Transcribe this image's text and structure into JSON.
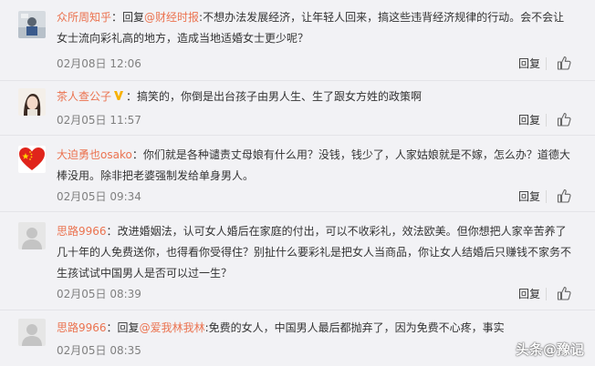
{
  "comments": [
    {
      "user": "众所周知乎",
      "pre": "：回复",
      "mention": "@财经时报",
      "body": ":不想办法发展经济，让年轻人回来，搞这些违背经济规律的行动。会不会让女士流向彩礼高的地方，造成当地适婚女士更少呢？",
      "time": "02月08日 12:06",
      "reply": "回复"
    },
    {
      "user": "茶人查公子",
      "pre": "：",
      "mention": "",
      "body": "搞笑的，你倒是出台孩子由男人生、生了跟女方姓的政策啊",
      "time": "02月05日 11:57",
      "reply": "回复"
    },
    {
      "user": "大迫勇也osako",
      "pre": "：",
      "mention": "",
      "body": "你们就是各种谴责丈母娘有什么用？没钱，钱少了，人家姑娘就是不嫁，怎么办？道德大棒没用。除非把老婆强制发给单身男人。",
      "time": "02月05日 09:34",
      "reply": "回复"
    },
    {
      "user": "思路9966",
      "pre": "：",
      "mention": "",
      "body": "改进婚姻法，认可女人婚后在家庭的付出，可以不收彩礼，效法欧美。但你想把人家辛苦养了几十年的人免费送你，也得看你受得住？别扯什么要彩礼是把女人当商品，你让女人结婚后只赚钱不家务不生孩试试中国男人是否可以过一生？",
      "time": "02月05日 08:39",
      "reply": "回复"
    },
    {
      "user": "思路9966",
      "pre": "：回复",
      "mention": "@爱我林我林",
      "body": ":免费的女人，中国男人最后都抛弃了，因为免费不心疼，事实",
      "time": "02月05日 08:35",
      "reply": "回复"
    }
  ],
  "watermark": "头条@豫记",
  "colors": {
    "link": "#eb7350",
    "time": "#808080",
    "background": "#f2f2f5"
  },
  "icons": {
    "like": "thumbs-up-icon",
    "verified": "verified-badge-icon"
  }
}
